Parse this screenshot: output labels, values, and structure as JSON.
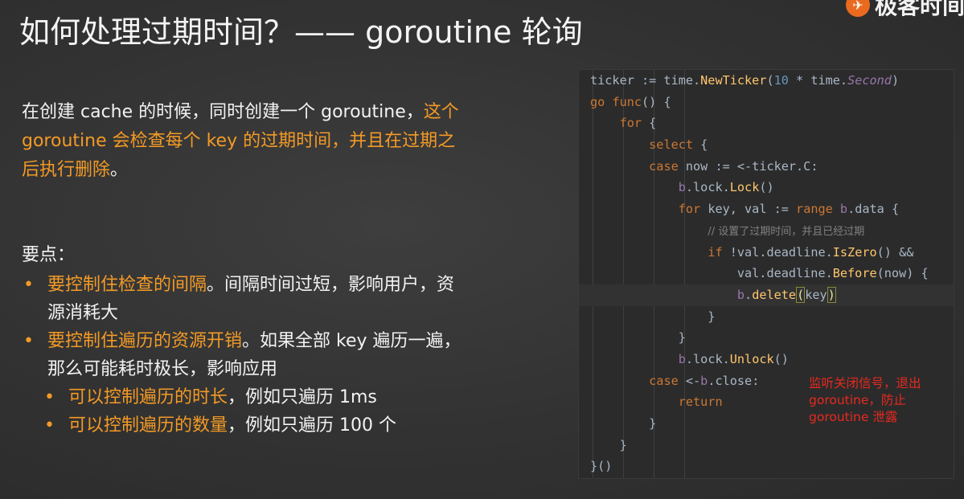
{
  "slide": {
    "title": "如何处理过期时间？—— goroutine 轮询",
    "logo_text": "极客时间"
  },
  "intro": {
    "part1": "在创建 cache 的时候，同时创建一个 goroutine，",
    "part2_highlight": "这个 goroutine 会检查每个 key 的过期时间，并且在过期之后执行删除",
    "part3": "。"
  },
  "points": {
    "heading": "要点：",
    "items": [
      {
        "highlight": "要控制住检查的间隔",
        "rest": "。间隔时间过短，影响用户，资源消耗大"
      },
      {
        "highlight": "要控制住遍历的资源开销",
        "rest": "。如果全部 key 遍历一遍，那么可能耗时极长，影响应用"
      }
    ],
    "sub_items": [
      {
        "highlight": "可以控制遍历的时长",
        "rest": "，例如只遍历 1ms"
      },
      {
        "highlight": "可以控制遍历的数量",
        "rest": "，例如只遍历 100 个"
      }
    ]
  },
  "code": {
    "comment": "// 设置了过期时间，并且已经过期",
    "annotation": "监听关闭信号，退出 goroutine，防止 goroutine 泄露"
  },
  "colors": {
    "accent_orange": "#f39a26",
    "annotation_red": "#e8291f",
    "code_bg": "#2b2b2b"
  }
}
